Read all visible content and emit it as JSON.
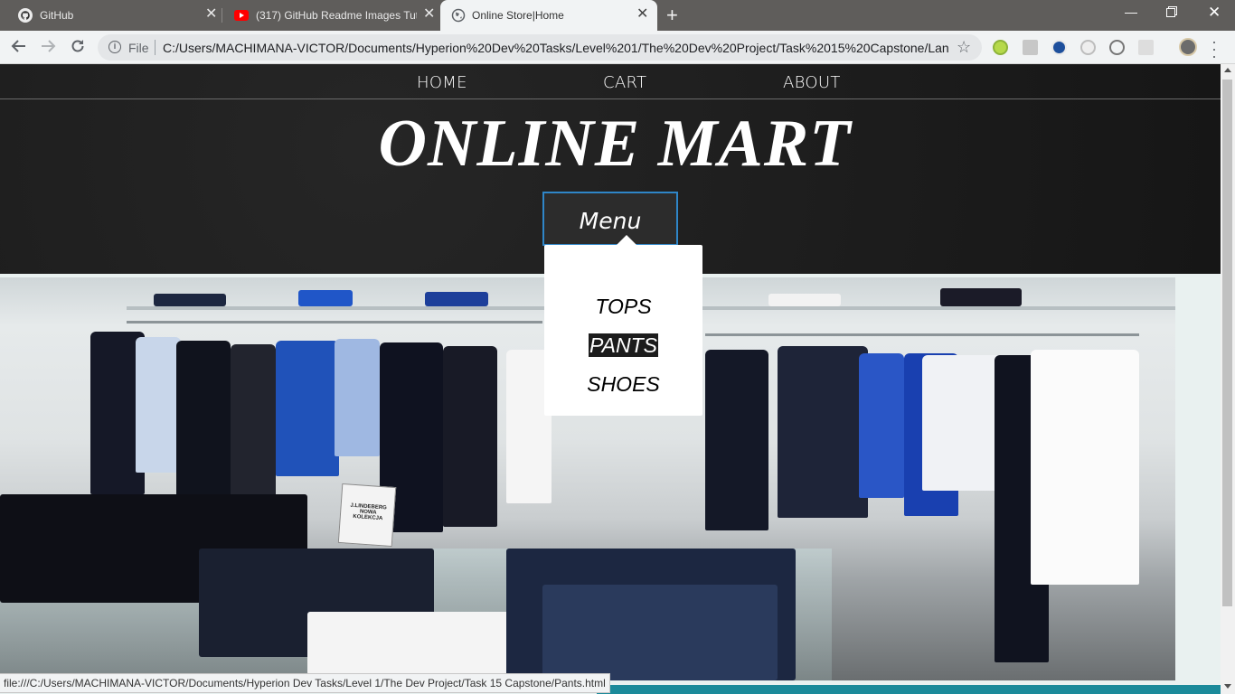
{
  "browser": {
    "tabs": [
      {
        "title": "GitHub",
        "icon": "github-icon",
        "active": false
      },
      {
        "title": "(317) GitHub Readme Images Tut",
        "icon": "youtube-icon",
        "active": false
      },
      {
        "title": "Online Store|Home",
        "icon": "globe-icon",
        "active": true
      }
    ],
    "new_tab_label": "+",
    "scheme_label": "File",
    "url": "C:/Users/MACHIMANA-VICTOR/Documents/Hyperion%20Dev%20Tasks/Level%201/The%20Dev%20Project/Task%2015%20Capstone/Land...",
    "status_url": "file:///C:/Users/MACHIMANA-VICTOR/Documents/Hyperion Dev Tasks/Level 1/The Dev Project/Task 15 Capstone/Pants.html",
    "accent_color": "#2f86c8"
  },
  "page": {
    "nav": {
      "home": "HOME",
      "cart": "CART",
      "about": "ABOUT"
    },
    "title": "ONLINE MART",
    "menu_button": "Menu",
    "dropdown": {
      "items": [
        "TOPS",
        "PANTS",
        "SHOES"
      ],
      "hovered": "PANTS"
    },
    "hero_sign": "J.LINDEBERG NOWA KOLEKCJA"
  }
}
